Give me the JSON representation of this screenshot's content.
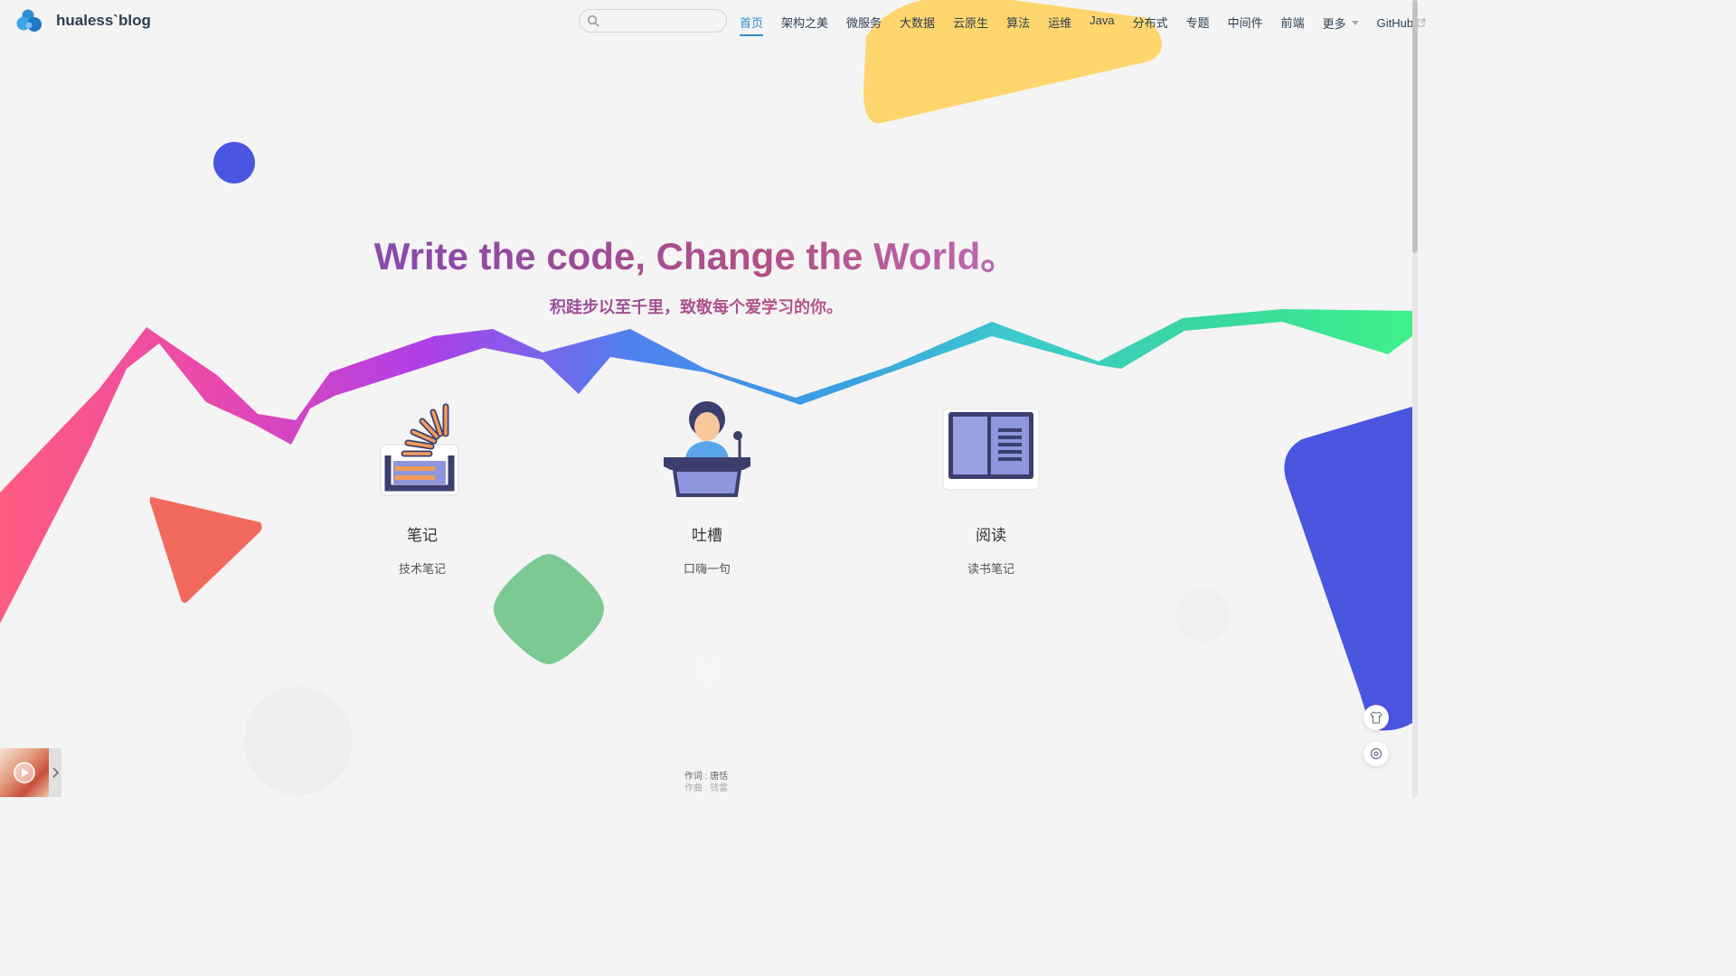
{
  "site": {
    "name": "hualess`blog"
  },
  "search": {
    "placeholder": ""
  },
  "nav": {
    "items": [
      {
        "label": "首页"
      },
      {
        "label": "架构之美"
      },
      {
        "label": "微服务"
      },
      {
        "label": "大数据"
      },
      {
        "label": "云原生"
      },
      {
        "label": "算法"
      },
      {
        "label": "运维"
      },
      {
        "label": "Java"
      },
      {
        "label": "分布式"
      },
      {
        "label": "专题"
      },
      {
        "label": "中间件"
      },
      {
        "label": "前端"
      },
      {
        "label": "更多"
      },
      {
        "label": "GitHub"
      }
    ]
  },
  "hero": {
    "title": "Write the code, Change the World。",
    "subtitle": "积跬步以至千里，致敬每个爱学习的你。"
  },
  "features": [
    {
      "title": "笔记",
      "desc": "技术笔记",
      "icon": "stack-overflow-icon"
    },
    {
      "title": "吐槽",
      "desc": "口嗨一句",
      "icon": "speaker-podium-icon"
    },
    {
      "title": "阅读",
      "desc": "读书笔记",
      "icon": "book-icon"
    }
  ],
  "lyrics": {
    "line1": "作词 : 唐恬",
    "line2": "作曲 : 钱雷"
  },
  "colors": {
    "accent": "#2a8fd1",
    "title_gradient_start": "#5b5bd6",
    "title_gradient_end": "#d08ad8"
  }
}
